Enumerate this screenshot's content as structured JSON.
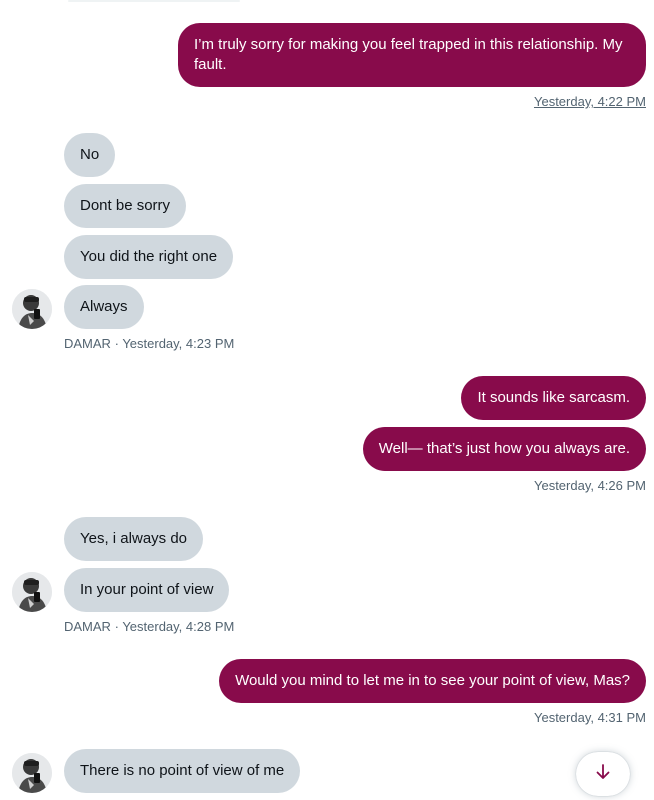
{
  "thread": {
    "group1": {
      "message": "I’m truly sorry for making you feel trapped in this relationship. My fault.",
      "timestamp": "Yesterday, 4:22 PM"
    },
    "group2": {
      "messages": [
        "No",
        "Dont be sorry",
        "You did the right one",
        "Always"
      ],
      "sender": "DAMAR",
      "separator": "·",
      "timestamp": "Yesterday, 4:23 PM"
    },
    "group3": {
      "messages": [
        "It sounds like sarcasm.",
        "Well— that’s just how you always are."
      ],
      "timestamp": "Yesterday, 4:26 PM"
    },
    "group4": {
      "messages": [
        "Yes, i always do",
        "In your point of view"
      ],
      "sender": "DAMAR",
      "separator": "·",
      "timestamp": "Yesterday, 4:28 PM"
    },
    "group5": {
      "message": "Would you mind to let me in to see your point of view, Mas?",
      "timestamp": "Yesterday, 4:31 PM"
    },
    "group6": {
      "message": "There is no point of view of me"
    }
  },
  "icons": {
    "scroll_down": "arrow-down-icon",
    "avatar": "avatar"
  },
  "colors": {
    "outgoing_bubble": "#880b4b",
    "incoming_bubble": "#d0d8de",
    "meta_text": "#536471"
  }
}
